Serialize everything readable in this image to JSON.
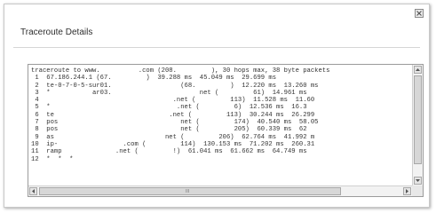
{
  "dialog": {
    "title": "Traceroute Details",
    "close_icon": "close-icon",
    "close_symbol": "✕"
  },
  "output": {
    "lines": [
      "traceroute to www.          .com (208.         ), 30 hops max, 38 byte packets",
      " 1  67.186.244.1 (67.         )  39.288 ms  45.049 ms  29.699 ms",
      " 2  te-0-7-0-5-sur01.                  (68.         )  12.220 ms  13.260 ms",
      " 3  *           ar03.                       net (         61)  14.961 ms",
      " 4                                   .net (         113)  11.528 ms  11.60",
      " 5  *                                 .net (         6)  12.536 ms  16.3",
      " 6  te                              .net (         113)  30.244 ms  26.299",
      " 7  pos                                net (         174)  40.540 ms  58.05",
      " 8  pos                                net (         205)  60.339 ms  62",
      " 9  as                             net (         206)  62.764 ms  41.992 m",
      "10  ip-                 .com (         114)  130.153 ms  71.202 ms  260.31",
      "11  ramp              .net (         !)  61.041 ms  61.662 ms  64.749 ms",
      "12  *  *  *"
    ]
  },
  "scrollbars": {
    "horizontal_grip": "III"
  },
  "colors": {
    "border": "#9b9b9b",
    "text": "#333333",
    "scroll_track": "#f2f2f2",
    "scroll_thumb": "#d7d7d7"
  }
}
